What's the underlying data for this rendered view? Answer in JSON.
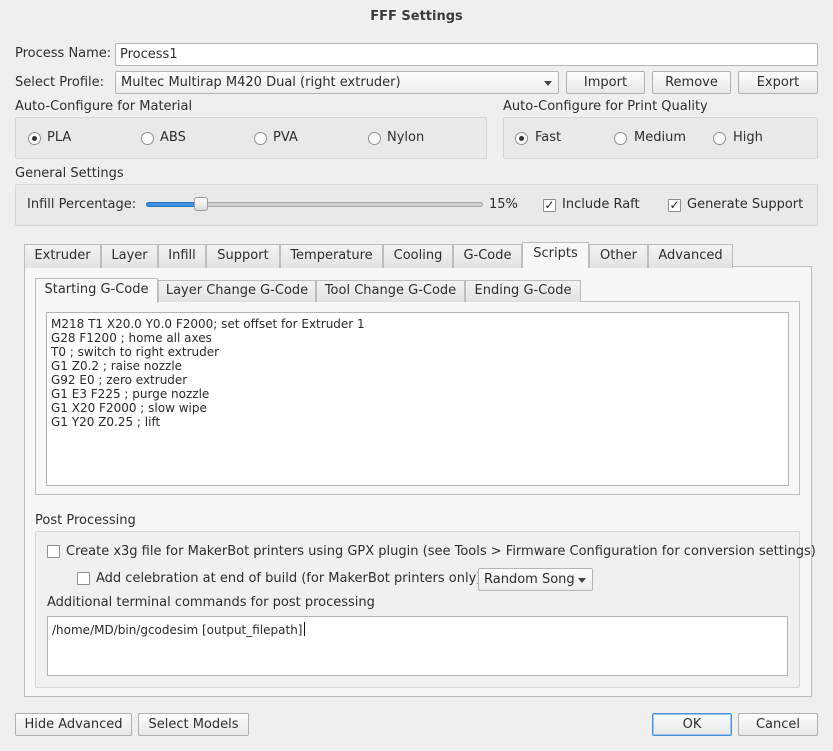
{
  "window": {
    "title": "FFF Settings"
  },
  "process": {
    "label": "Process Name:",
    "value": "Process1"
  },
  "profile": {
    "label": "Select Profile:",
    "selected": "Multec Multirap M420 Dual (right extruder)",
    "buttons": {
      "import": "Import",
      "remove": "Remove",
      "export": "Export"
    }
  },
  "material": {
    "title": "Auto-Configure for Material",
    "options": [
      "PLA",
      "ABS",
      "PVA",
      "Nylon"
    ],
    "selected": "PLA"
  },
  "quality": {
    "title": "Auto-Configure for Print Quality",
    "options": [
      "Fast",
      "Medium",
      "High"
    ],
    "selected": "Fast"
  },
  "general": {
    "title": "General Settings",
    "infill_label": "Infill Percentage:",
    "infill_fraction": 0.15,
    "infill_text": "15%",
    "raft_label": "Include Raft",
    "raft_checked": true,
    "support_label": "Generate Support",
    "support_checked": true
  },
  "tabs": {
    "items": [
      "Extruder",
      "Layer",
      "Infill",
      "Support",
      "Temperature",
      "Cooling",
      "G-Code",
      "Scripts",
      "Other",
      "Advanced"
    ],
    "active": "Scripts"
  },
  "subtabs": {
    "items": [
      "Starting G-Code",
      "Layer Change G-Code",
      "Tool Change G-Code",
      "Ending G-Code"
    ],
    "active": "Starting G-Code"
  },
  "gcode": {
    "lines": [
      "M218 T1 X20.0 Y0.0 F2000; set offset for Extruder 1",
      "G28 F1200 ; home all axes",
      "T0 ; switch to right extruder",
      "G1 Z0.2 ; raise nozzle",
      "G92 E0 ; zero extruder",
      "G1 E3 F225 ; purge nozzle",
      "G1 X20 F2000 ; slow wipe",
      "G1 Y20 Z0.25 ; lift"
    ]
  },
  "post": {
    "title": "Post Processing",
    "x3g_label": "Create x3g file for MakerBot printers using GPX plugin (see Tools > Firmware Configuration for conversion settings)",
    "x3g_checked": false,
    "celebration_label": "Add celebration at end of build (for MakerBot printers only)",
    "celebration_checked": false,
    "song": "Random Song",
    "commands_label": "Additional terminal commands for post processing",
    "commands_value": "/home/MD/bin/gcodesim [output_filepath]"
  },
  "footer": {
    "hide_advanced": "Hide Advanced",
    "select_models": "Select Models",
    "ok": "OK",
    "cancel": "Cancel"
  }
}
